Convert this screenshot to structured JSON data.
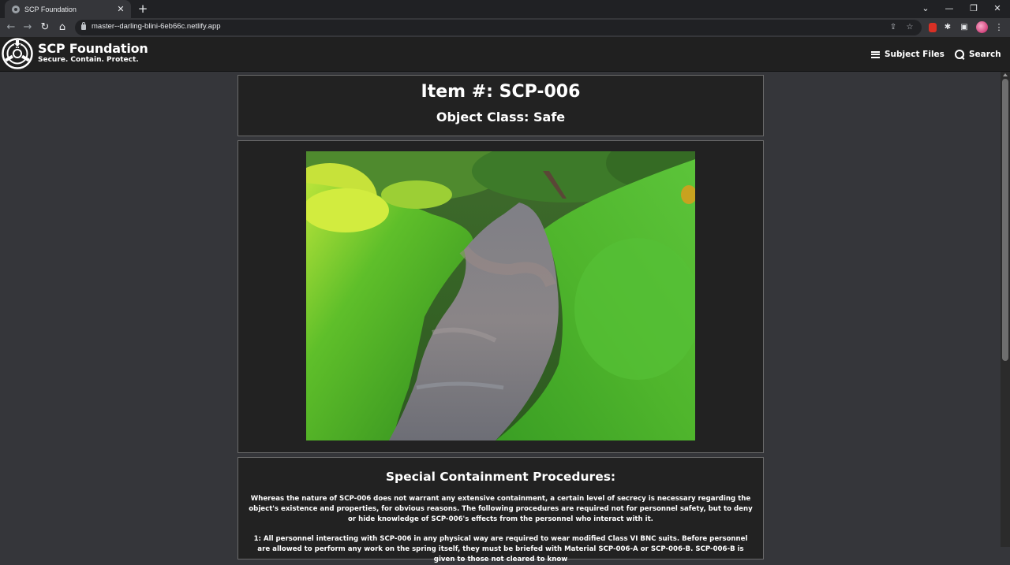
{
  "browser": {
    "tab_title": "SCP Foundation",
    "tab_close": "✕",
    "new_tab": "+",
    "url": "master--darling-blini-6eb66c.netlify.app",
    "window_controls": {
      "chevron": "⌄",
      "minimize": "—",
      "restore": "❐",
      "close": "✕"
    },
    "nav": {
      "back": "←",
      "forward": "→",
      "reload": "↻",
      "home": "⌂"
    },
    "omnibox_icons": {
      "share": "⇪",
      "bookmark": "☆"
    },
    "extensions": {
      "puzzle": "✱",
      "side_panel": "▣"
    },
    "menu": "⋮"
  },
  "header": {
    "brand_title": "SCP Foundation",
    "brand_tagline": "Secure. Contain. Protect.",
    "nav": {
      "subject_files": "Subject Files",
      "search": "Search"
    }
  },
  "item": {
    "number": "Item #: SCP-006",
    "object_class": "Object Class: Safe"
  },
  "procedures": {
    "heading": "Special Containment Procedures:",
    "paragraph_1": "Whereas the nature of SCP-006 does not warrant any extensive containment, a certain level of secrecy is necessary regarding the object's existence and properties, for obvious reasons. The following procedures are required not for personnel safety, but to deny or hide knowledge of SCP-006's effects from the personnel who interact with it.",
    "paragraph_2": "1: All personnel interacting with SCP-006 in any physical way are required to wear modified Class VI BNC suits. Before personnel are allowed to perform any work on the spring itself, they must be briefed with Material SCP-006-A or SCP-006-B. SCP-006-B is given to those not cleared to know"
  }
}
